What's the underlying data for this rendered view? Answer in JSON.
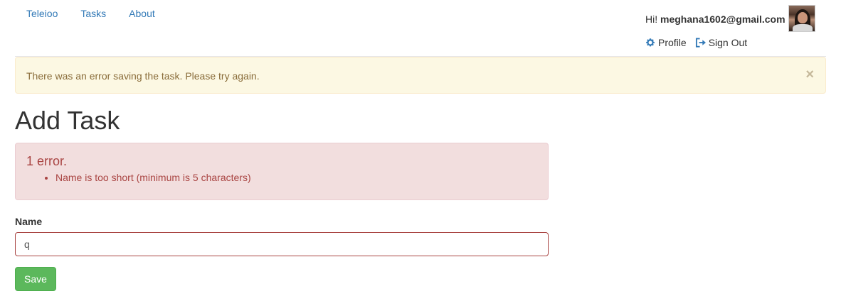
{
  "nav": {
    "links": [
      "Teleioo",
      "Tasks",
      "About"
    ]
  },
  "user": {
    "greeting_prefix": "Hi!",
    "email": "meghana1602@gmail.com",
    "profile_label": "Profile",
    "signout_label": "Sign Out"
  },
  "alert": {
    "message": "There was an error saving the task. Please try again.",
    "close_symbol": "×"
  },
  "page": {
    "title": "Add Task"
  },
  "errors": {
    "title": "1 error.",
    "items": [
      "Name is too short (minimum is 5 characters)"
    ]
  },
  "form": {
    "name_label": "Name",
    "name_value": "q",
    "save_label": "Save"
  },
  "colors": {
    "link": "#337ab7",
    "warning_bg": "#fcf8e3",
    "danger_bg": "#f2dede",
    "danger_text": "#a94442",
    "success": "#5cb85c"
  },
  "icons": {
    "profile": "gear-icon",
    "signout": "sign-out-icon"
  }
}
